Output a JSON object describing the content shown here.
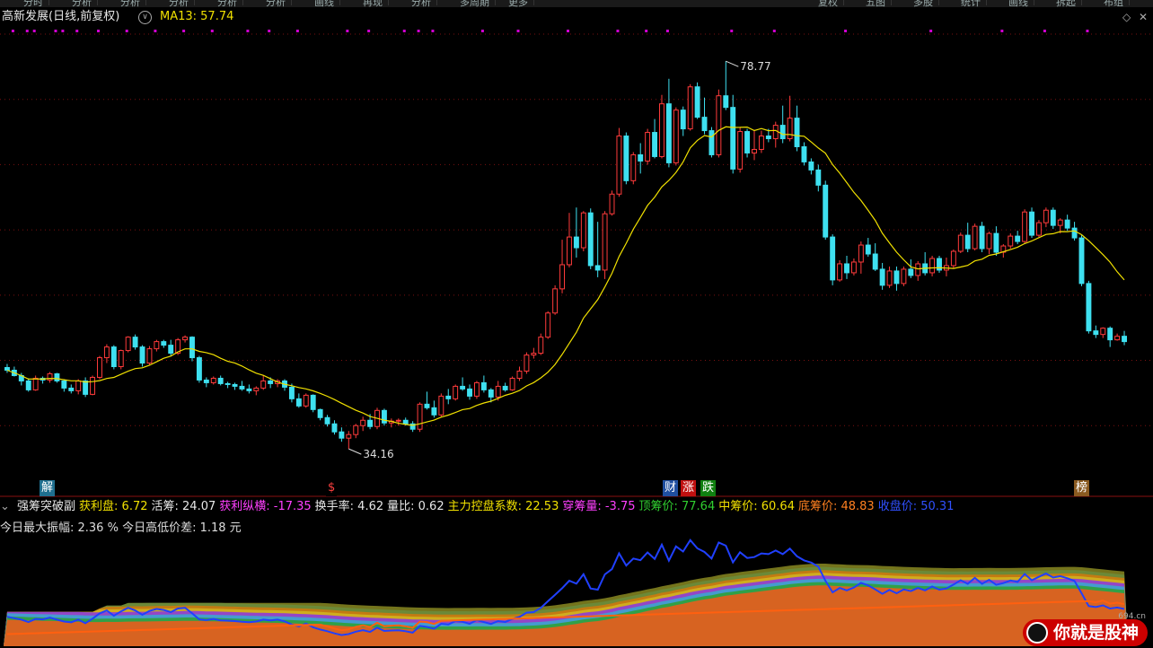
{
  "header": {
    "stock_label": "高新发展(日线,前复权)",
    "ma_label": "MA13: 57.74",
    "circle_glyph": "∨",
    "diamond_glyph": "◇",
    "close_glyph": "✕"
  },
  "topbar_items": [
    "分时",
    "分析",
    "分析",
    "分析",
    "分析",
    "分析",
    "画线",
    "再现",
    "分析",
    "多周期",
    "更多",
    "复权",
    "五图",
    "多股",
    "统计",
    "画线",
    "拆起",
    "布组"
  ],
  "colors": {
    "up": "#ff3b3b",
    "down": "#3ee0f0",
    "ma": "#f0e000",
    "bg": "#000000"
  },
  "annotations": {
    "high_label": "78.77",
    "low_label": "34.16"
  },
  "tags": [
    {
      "text": "解",
      "color": "#fff",
      "bg": "#1f6f8f"
    },
    {
      "text": "$",
      "color": "#ff4040",
      "bg": "#000"
    },
    {
      "text": "财",
      "color": "#fff",
      "bg": "#1f4fa0"
    },
    {
      "text": "涨",
      "color": "#fff",
      "bg": "#c01010"
    },
    {
      "text": "跌",
      "color": "#fff",
      "bg": "#108010"
    },
    {
      "text": "榜",
      "color": "#fff",
      "bg": "#8a5a20"
    }
  ],
  "indicator": {
    "name": "强筹突破副",
    "items": [
      {
        "label": "获利盘:",
        "value": "6.72",
        "color": "#f0e000"
      },
      {
        "label": "活筹:",
        "value": "24.07",
        "color": "#e8e8e8"
      },
      {
        "label": "获利纵横:",
        "value": "-17.35",
        "color": "#ff40ff"
      },
      {
        "label": "换手率:",
        "value": "4.62",
        "color": "#e8e8e8"
      },
      {
        "label": "量比:",
        "value": "0.62",
        "color": "#e8e8e8"
      },
      {
        "label": "主力控盘系数:",
        "value": "22.53",
        "color": "#f0e000"
      },
      {
        "label": "穿筹量:",
        "value": "-3.75",
        "color": "#ff40ff"
      },
      {
        "label": "顶筹价:",
        "value": "77.64",
        "color": "#30d030"
      },
      {
        "label": "中筹价:",
        "value": "60.64",
        "color": "#f0e000"
      },
      {
        "label": "底筹价:",
        "value": "48.83",
        "color": "#ff8020"
      },
      {
        "label": "收盘价:",
        "value": "50.31",
        "color": "#3050ff"
      }
    ],
    "line2": "今日最大振幅: 2.36 %  今日高低价差: 1.18 元"
  },
  "watermark": {
    "text": "你就是股神",
    "sub": "694.cn"
  },
  "chart_data": {
    "type": "candlestick",
    "title": "高新发展(日线,前复权)",
    "ylim": [
      32,
      82
    ],
    "ma_series": {
      "name": "MA13",
      "last": 57.74
    },
    "candles": [
      [
        44.5,
        44.9,
        43.9,
        44.2
      ],
      [
        44.2,
        44.6,
        43.5,
        43.6
      ],
      [
        43.6,
        43.9,
        42.5,
        43.0
      ],
      [
        43.0,
        43.3,
        41.8,
        42.0
      ],
      [
        42.0,
        43.6,
        41.9,
        43.3
      ],
      [
        43.3,
        43.5,
        42.7,
        43.1
      ],
      [
        43.1,
        44.0,
        42.8,
        43.8
      ],
      [
        43.8,
        43.9,
        42.8,
        43.0
      ],
      [
        43.0,
        43.2,
        41.8,
        42.2
      ],
      [
        42.2,
        42.6,
        41.6,
        41.9
      ],
      [
        41.9,
        43.2,
        41.5,
        43.0
      ],
      [
        43.0,
        43.4,
        41.2,
        41.5
      ],
      [
        41.5,
        43.6,
        41.4,
        43.4
      ],
      [
        43.4,
        45.8,
        43.2,
        45.6
      ],
      [
        45.6,
        47.1,
        45.0,
        46.8
      ],
      [
        46.8,
        47.0,
        44.3,
        44.6
      ],
      [
        44.6,
        46.5,
        44.3,
        46.4
      ],
      [
        46.4,
        48.0,
        46.2,
        47.9
      ],
      [
        47.9,
        48.2,
        46.5,
        46.8
      ],
      [
        46.8,
        47.0,
        44.6,
        45.0
      ],
      [
        45.0,
        46.9,
        44.8,
        46.6
      ],
      [
        46.6,
        47.6,
        46.3,
        47.4
      ],
      [
        47.4,
        47.6,
        46.7,
        47.0
      ],
      [
        47.0,
        47.6,
        45.8,
        46.1
      ],
      [
        46.1,
        47.8,
        45.9,
        47.6
      ],
      [
        47.6,
        48.1,
        47.3,
        47.9
      ],
      [
        47.9,
        48.0,
        45.2,
        45.6
      ],
      [
        45.6,
        45.8,
        42.8,
        43.1
      ],
      [
        43.1,
        43.4,
        42.3,
        42.8
      ],
      [
        42.8,
        43.5,
        42.6,
        43.3
      ],
      [
        43.3,
        43.6,
        42.5,
        42.7
      ],
      [
        42.7,
        42.9,
        42.2,
        42.6
      ],
      [
        42.6,
        42.8,
        42.0,
        42.4
      ],
      [
        42.4,
        43.0,
        41.9,
        42.1
      ],
      [
        42.1,
        42.6,
        41.6,
        41.9
      ],
      [
        41.9,
        42.4,
        41.4,
        42.2
      ],
      [
        42.2,
        43.6,
        42.0,
        43.0
      ],
      [
        43.0,
        43.4,
        42.2,
        42.7
      ],
      [
        42.7,
        43.2,
        42.3,
        43.0
      ],
      [
        43.0,
        43.2,
        41.9,
        42.3
      ],
      [
        42.3,
        42.7,
        40.6,
        41.0
      ],
      [
        41.0,
        41.6,
        40.0,
        40.2
      ],
      [
        40.2,
        41.6,
        40.0,
        41.4
      ],
      [
        41.4,
        41.5,
        39.5,
        39.8
      ],
      [
        39.8,
        39.9,
        38.6,
        38.9
      ],
      [
        38.9,
        39.2,
        37.9,
        38.2
      ],
      [
        38.2,
        38.6,
        37.0,
        37.3
      ],
      [
        37.3,
        37.8,
        36.2,
        36.6
      ],
      [
        36.6,
        37.4,
        35.4,
        37.0
      ],
      [
        37.0,
        38.2,
        36.6,
        38.0
      ],
      [
        38.0,
        39.0,
        37.4,
        38.6
      ],
      [
        38.6,
        39.3,
        37.6,
        37.9
      ],
      [
        37.9,
        40.0,
        37.6,
        39.7
      ],
      [
        39.7,
        39.9,
        38.0,
        38.3
      ],
      [
        38.3,
        38.8,
        37.8,
        38.5
      ],
      [
        38.5,
        38.8,
        38.0,
        38.6
      ],
      [
        38.6,
        38.9,
        38.0,
        38.2
      ],
      [
        38.2,
        38.5,
        37.3,
        37.6
      ],
      [
        37.6,
        40.6,
        37.3,
        40.4
      ],
      [
        40.4,
        41.8,
        39.8,
        40.0
      ],
      [
        40.0,
        40.8,
        38.9,
        39.2
      ],
      [
        39.2,
        41.6,
        39.0,
        41.3
      ],
      [
        41.3,
        42.1,
        40.4,
        41.0
      ],
      [
        41.0,
        42.6,
        40.8,
        42.4
      ],
      [
        42.4,
        43.4,
        41.9,
        42.1
      ],
      [
        42.1,
        42.6,
        40.9,
        41.3
      ],
      [
        41.3,
        43.0,
        41.0,
        42.8
      ],
      [
        42.8,
        43.6,
        41.7,
        42.0
      ],
      [
        42.0,
        42.2,
        40.6,
        41.2
      ],
      [
        41.2,
        43.0,
        40.8,
        42.4
      ],
      [
        42.4,
        42.8,
        41.8,
        42.0
      ],
      [
        42.0,
        43.5,
        41.9,
        43.3
      ],
      [
        43.3,
        44.6,
        43.0,
        44.1
      ],
      [
        44.1,
        46.2,
        43.8,
        45.9
      ],
      [
        45.9,
        46.7,
        45.5,
        46.1
      ],
      [
        46.1,
        48.3,
        45.9,
        47.9
      ],
      [
        47.9,
        50.8,
        47.7,
        50.6
      ],
      [
        50.6,
        53.7,
        50.4,
        53.3
      ],
      [
        53.3,
        58.8,
        52.8,
        56.0
      ],
      [
        56.0,
        61.8,
        55.7,
        59.1
      ],
      [
        59.1,
        62.4,
        56.8,
        57.9
      ],
      [
        57.9,
        62.0,
        57.5,
        61.8
      ],
      [
        61.8,
        62.3,
        55.5,
        55.9
      ],
      [
        55.9,
        60.8,
        54.6,
        55.4
      ],
      [
        55.4,
        62.0,
        54.4,
        61.7
      ],
      [
        61.7,
        64.3,
        61.5,
        63.9
      ],
      [
        63.9,
        71.3,
        63.6,
        70.4
      ],
      [
        70.4,
        70.8,
        65.0,
        65.4
      ],
      [
        65.4,
        68.6,
        65.0,
        68.3
      ],
      [
        68.3,
        69.6,
        66.2,
        67.6
      ],
      [
        67.6,
        71.2,
        67.2,
        70.8
      ],
      [
        70.8,
        72.3,
        67.9,
        68.1
      ],
      [
        68.1,
        75.0,
        67.9,
        74.0
      ],
      [
        74.0,
        76.8,
        66.9,
        67.4
      ],
      [
        67.4,
        73.6,
        67.1,
        73.3
      ],
      [
        73.3,
        73.7,
        70.4,
        71.2
      ],
      [
        71.2,
        76.2,
        71.0,
        75.9
      ],
      [
        75.9,
        76.4,
        72.3,
        72.5
      ],
      [
        72.5,
        74.7,
        70.6,
        71.0
      ],
      [
        71.0,
        71.4,
        68.0,
        68.3
      ],
      [
        68.3,
        75.6,
        68.0,
        74.9
      ],
      [
        74.9,
        78.77,
        73.3,
        73.6
      ],
      [
        73.6,
        75.0,
        66.2,
        66.7
      ],
      [
        66.7,
        71.4,
        66.3,
        70.9
      ],
      [
        70.9,
        71.2,
        68.0,
        68.5
      ],
      [
        68.5,
        71.1,
        67.7,
        68.9
      ],
      [
        68.9,
        71.0,
        68.5,
        70.4
      ],
      [
        70.4,
        71.2,
        69.7,
        70.1
      ],
      [
        70.1,
        72.0,
        69.1,
        71.6
      ],
      [
        71.6,
        73.8,
        69.6,
        70.1
      ],
      [
        70.1,
        74.9,
        69.8,
        72.4
      ],
      [
        72.4,
        73.8,
        68.7,
        69.2
      ],
      [
        69.2,
        69.7,
        67.1,
        67.5
      ],
      [
        67.5,
        67.9,
        66.1,
        66.6
      ],
      [
        66.6,
        67.2,
        64.2,
        64.9
      ],
      [
        64.9,
        65.4,
        58.8,
        59.1
      ],
      [
        59.1,
        59.4,
        53.7,
        54.3
      ],
      [
        54.3,
        56.5,
        54.1,
        56.1
      ],
      [
        56.1,
        57.0,
        54.4,
        55.1
      ],
      [
        55.1,
        56.7,
        54.8,
        56.3
      ],
      [
        56.3,
        58.6,
        55.0,
        58.2
      ],
      [
        58.2,
        59.0,
        56.9,
        57.2
      ],
      [
        57.2,
        58.4,
        55.3,
        55.5
      ],
      [
        55.5,
        56.2,
        53.2,
        53.7
      ],
      [
        53.7,
        55.8,
        53.4,
        55.3
      ],
      [
        55.3,
        55.8,
        53.1,
        53.9
      ],
      [
        53.9,
        55.8,
        53.6,
        55.5
      ],
      [
        55.5,
        56.6,
        54.5,
        54.8
      ],
      [
        54.8,
        56.4,
        54.2,
        56.1
      ],
      [
        56.1,
        57.4,
        54.8,
        55.1
      ],
      [
        55.1,
        57.0,
        54.7,
        56.7
      ],
      [
        56.7,
        57.0,
        55.1,
        55.4
      ],
      [
        55.4,
        56.8,
        54.7,
        55.9
      ],
      [
        55.9,
        57.7,
        55.6,
        57.5
      ],
      [
        57.5,
        59.6,
        57.3,
        59.3
      ],
      [
        59.3,
        60.7,
        57.4,
        57.8
      ],
      [
        57.8,
        60.6,
        57.6,
        60.3
      ],
      [
        60.3,
        60.8,
        57.4,
        57.8
      ],
      [
        57.8,
        59.7,
        57.2,
        59.5
      ],
      [
        59.5,
        60.3,
        57.0,
        57.4
      ],
      [
        57.4,
        58.3,
        56.8,
        58.1
      ],
      [
        58.1,
        59.5,
        57.8,
        59.2
      ],
      [
        59.2,
        59.8,
        58.3,
        58.6
      ],
      [
        58.6,
        62.2,
        58.4,
        61.9
      ],
      [
        61.9,
        62.4,
        59.0,
        59.3
      ],
      [
        59.3,
        61.0,
        59.1,
        60.7
      ],
      [
        60.7,
        62.4,
        60.2,
        62.1
      ],
      [
        62.1,
        62.4,
        60.0,
        60.4
      ],
      [
        60.4,
        61.2,
        59.5,
        61.0
      ],
      [
        61.0,
        61.6,
        59.8,
        60.1
      ],
      [
        60.1,
        60.8,
        58.7,
        59.0
      ],
      [
        59.0,
        59.3,
        53.6,
        53.9
      ],
      [
        53.9,
        54.2,
        48.3,
        48.6
      ],
      [
        48.6,
        49.2,
        47.8,
        48.2
      ],
      [
        48.2,
        49.0,
        47.8,
        48.9
      ],
      [
        48.9,
        49.1,
        46.8,
        47.6
      ],
      [
        47.6,
        48.3,
        47.5,
        48.0
      ],
      [
        48.0,
        48.6,
        47.0,
        47.4
      ]
    ]
  }
}
